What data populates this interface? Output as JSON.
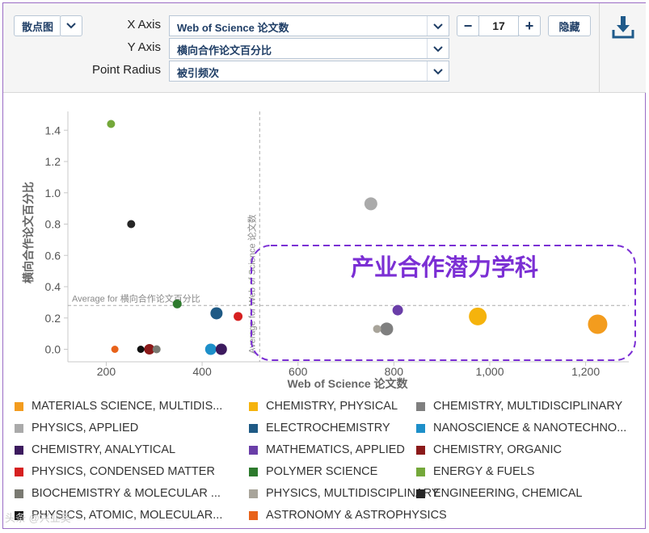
{
  "controls": {
    "chart_type_label": "散点图",
    "x_axis_label": "X Axis",
    "y_axis_label": "Y Axis",
    "radius_label": "Point Radius",
    "x_axis_value": "Web of Science 论文数",
    "y_axis_value": "横向合作论文百分比",
    "radius_value": "被引频次",
    "count_value": "17",
    "minus_symbol": "−",
    "plus_symbol": "+",
    "hide_label": "隐藏"
  },
  "annotation": {
    "label": "产业合作潜力学科",
    "color": "#7b2fd4"
  },
  "watermark": "头条 @兴业奥",
  "chart_data": {
    "type": "scatter",
    "xlabel": "Web of Science 论文数",
    "ylabel": "横向合作论文百分比",
    "xlim": [
      120,
      1290
    ],
    "ylim": [
      -0.08,
      1.52
    ],
    "x_ticks": [
      200,
      400,
      600,
      800,
      1000,
      1200
    ],
    "x_tick_labels": [
      "200",
      "400",
      "600",
      "800",
      "1,000",
      "1,200"
    ],
    "y_ticks": [
      0.0,
      0.2,
      0.4,
      0.6,
      0.8,
      1.0,
      1.2,
      1.4
    ],
    "y_tick_labels": [
      "0.0",
      "0.2",
      "0.4",
      "0.6",
      "0.8",
      "1.0",
      "1.2",
      "1.4"
    ],
    "avg_x": 520,
    "avg_y": 0.28,
    "avg_x_label": "Average for Web of Science 论文数",
    "avg_y_label": "Average for 横向合作论文百分比",
    "grid": false,
    "legend_position": "bottom",
    "series": [
      {
        "name": "MATERIALS SCIENCE, MULTIDIS...",
        "color": "#f39c1e",
        "x": 1225,
        "y": 0.16,
        "r": 12
      },
      {
        "name": "CHEMISTRY, PHYSICAL",
        "color": "#f5b30c",
        "x": 975,
        "y": 0.21,
        "r": 11
      },
      {
        "name": "CHEMISTRY, MULTIDISCIPLINARY",
        "color": "#7f7f7f",
        "x": 785,
        "y": 0.13,
        "r": 8
      },
      {
        "name": "PHYSICS, APPLIED",
        "color": "#aaaaaa",
        "x": 752,
        "y": 0.93,
        "r": 8
      },
      {
        "name": "ELECTROCHEMISTRY",
        "color": "#1f5a85",
        "x": 430,
        "y": 0.23,
        "r": 7.5
      },
      {
        "name": "NANOSCIENCE & NANOTECHNO...",
        "color": "#1d8fc9",
        "x": 418,
        "y": 0.0,
        "r": 7
      },
      {
        "name": "CHEMISTRY, ANALYTICAL",
        "color": "#3c1a5e",
        "x": 440,
        "y": 0.0,
        "r": 7
      },
      {
        "name": "MATHEMATICS, APPLIED",
        "color": "#6a3ea8",
        "x": 808,
        "y": 0.25,
        "r": 6.5
      },
      {
        "name": "CHEMISTRY, ORGANIC",
        "color": "#8b1a1a",
        "x": 290,
        "y": 0.0,
        "r": 6.5
      },
      {
        "name": "PHYSICS, CONDENSED MATTER",
        "color": "#d62020",
        "x": 475,
        "y": 0.21,
        "r": 5.5
      },
      {
        "name": "POLYMER SCIENCE",
        "color": "#2d7a2d",
        "x": 348,
        "y": 0.29,
        "r": 5.5
      },
      {
        "name": "ENERGY & FUELS",
        "color": "#74a83a",
        "x": 210,
        "y": 1.44,
        "r": 5
      },
      {
        "name": "BIOCHEMISTRY & MOLECULAR ...",
        "color": "#7a7a72",
        "x": 305,
        "y": 0.0,
        "r": 5
      },
      {
        "name": "PHYSICS, MULTIDISCIPLINARY",
        "color": "#a8a49a",
        "x": 765,
        "y": 0.13,
        "r": 5
      },
      {
        "name": "ENGINEERING, CHEMICAL",
        "color": "#262626",
        "x": 252,
        "y": 0.8,
        "r": 5
      },
      {
        "name": "PHYSICS, ATOMIC, MOLECULAR...",
        "color": "#111111",
        "x": 272,
        "y": 0.0,
        "r": 4.5
      },
      {
        "name": "ASTRONOMY & ASTROPHYSICS",
        "color": "#e8621a",
        "x": 218,
        "y": 0.0,
        "r": 4.5
      }
    ]
  }
}
